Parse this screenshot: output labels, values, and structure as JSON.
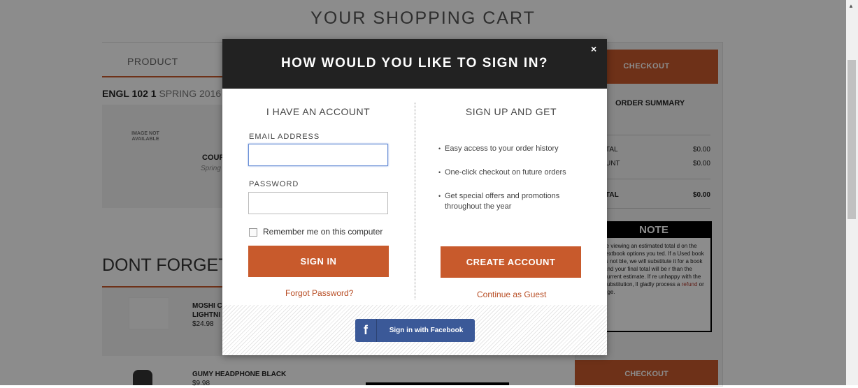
{
  "page": {
    "title": "YOUR SHOPPING CART",
    "product_header": "PRODUCT",
    "course_name": "ENGL 102 1",
    "course_term": "SPRING 2016",
    "image_not_available": "IMAGE NOT AVAILABLE",
    "course_item_title": "COUR",
    "course_item_term": "Spring",
    "dont_forget": "DONT FORGET",
    "products": [
      {
        "name": "MOSHI C",
        "name2": "LIGHTNI",
        "price": "$24.98"
      },
      {
        "name": "GUMY HEADPHONE BLACK",
        "price": "$9.98"
      }
    ]
  },
  "sidebar": {
    "checkout_label": "CHECKOUT",
    "order_summary": "ORDER SUMMARY",
    "rows": [
      {
        "label": "TAL",
        "value": "$0.00"
      },
      {
        "label": "UNT",
        "value": "$0.00"
      },
      {
        "label": "TAL",
        "value": "$0.00"
      }
    ],
    "note_title": "NOTE",
    "note_text_before": "re viewing an estimated total d on the textbook options you ted. If a Used book is not ble, we will substitute it for a book and your final total will be r than the current estimate. If re unhappy with the substitution, ll gladly process a ",
    "note_link": "refund",
    "note_text_after": " or nge."
  },
  "modal": {
    "title": "HOW WOULD YOU LIKE TO SIGN IN?",
    "close": "×",
    "account_title": "I HAVE AN ACCOUNT",
    "email_label": "EMAIL ADDRESS",
    "email_value": "",
    "password_label": "PASSWORD",
    "password_value": "",
    "remember_label": "Remember me on this computer",
    "sign_in_label": "SIGN IN",
    "forgot_label": "Forgot Password?",
    "signup_title": "SIGN UP AND GET",
    "benefits": [
      "Easy access to your order history",
      "One-click checkout on future orders",
      "Get special offers and promotions throughout the year"
    ],
    "create_label": "CREATE ACCOUNT",
    "guest_label": "Continue as Guest",
    "facebook_logo": "f",
    "facebook_label": "Sign in with Facebook"
  },
  "colors": {
    "accent": "#c85a2c",
    "modal_header": "#222222",
    "facebook": "#3b5998"
  }
}
